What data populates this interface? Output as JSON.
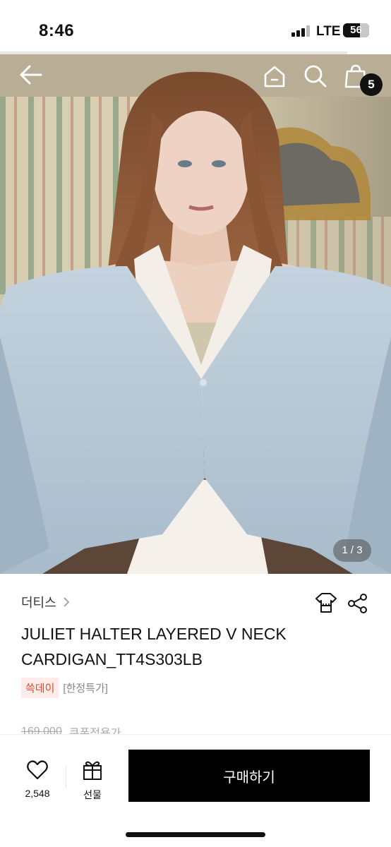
{
  "status_bar": {
    "time": "8:46",
    "network": "LTE",
    "battery": "56"
  },
  "hero": {
    "page_indicator": "1 / 3",
    "cart_count": "5",
    "image_subject": "model wearing light blue V-neck cardigan over white halter top"
  },
  "product": {
    "brand": "더티스",
    "title_line1": "JULIET HALTER LAYERED V NECK",
    "title_line2": "CARDIGAN_TT4S303LB",
    "tag_event": "쓱데이",
    "tag_limited": "[한정특가]",
    "price_original": "169,000",
    "price_coupon_label": "쿠폰적용가"
  },
  "bottom_bar": {
    "like_count": "2,548",
    "gift_label": "선물",
    "buy_label": "구매하기"
  },
  "colors": {
    "accent_tag_bg": "#fdecea",
    "accent_tag_text": "#e04a2e",
    "cardigan": "#b7c8d6",
    "buy_button": "#000000"
  },
  "icons": [
    "back-arrow-icon",
    "home-icon",
    "search-icon",
    "shopping-bag-icon",
    "chevron-right-icon",
    "size-fit-icon",
    "share-icon",
    "heart-icon",
    "gift-icon"
  ]
}
